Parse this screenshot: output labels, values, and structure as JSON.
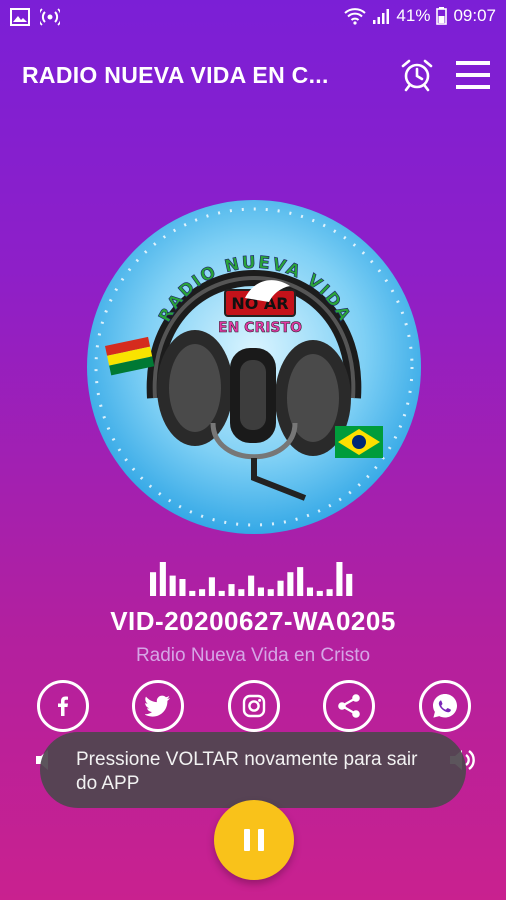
{
  "status_bar": {
    "battery": "41%",
    "time": "09:07",
    "icons": [
      "image-icon",
      "broadcast-icon",
      "wifi-icon",
      "signal-icon",
      "battery-icon"
    ]
  },
  "app_bar": {
    "title": "RADIO NUEVA VIDA EN C...",
    "icons": [
      "alarm-icon",
      "menu-icon"
    ]
  },
  "logo": {
    "top_arc_text": "RADIO NUEVA VIDA",
    "on_air_text": "NO AR",
    "bottom_text": "EN CRISTO"
  },
  "player": {
    "track_title": "VID-20200627-WA0205",
    "station_name": "Radio Nueva Vida en Cristo",
    "equalizer_levels": [
      0.7,
      1,
      0.6,
      0.5,
      0.15,
      0.2,
      0.55,
      0.15,
      0.35,
      0.2,
      0.6,
      0.25,
      0.2,
      0.45,
      0.7,
      0.85,
      0.25,
      0.15,
      0.2,
      1,
      0.65
    ]
  },
  "social": [
    {
      "name": "facebook",
      "glyph": "f"
    },
    {
      "name": "twitter",
      "glyph": ""
    },
    {
      "name": "instagram",
      "glyph": ""
    },
    {
      "name": "share",
      "glyph": ""
    },
    {
      "name": "whatsapp",
      "glyph": ""
    }
  ],
  "toast": {
    "message": "Pressione VOLTAR novamente para sair do APP"
  },
  "colors": {
    "gradient_top": "#7b1fd6",
    "gradient_bottom": "#c9218f",
    "play_button": "#f9c21a",
    "station_name": "#d6a5e6"
  }
}
